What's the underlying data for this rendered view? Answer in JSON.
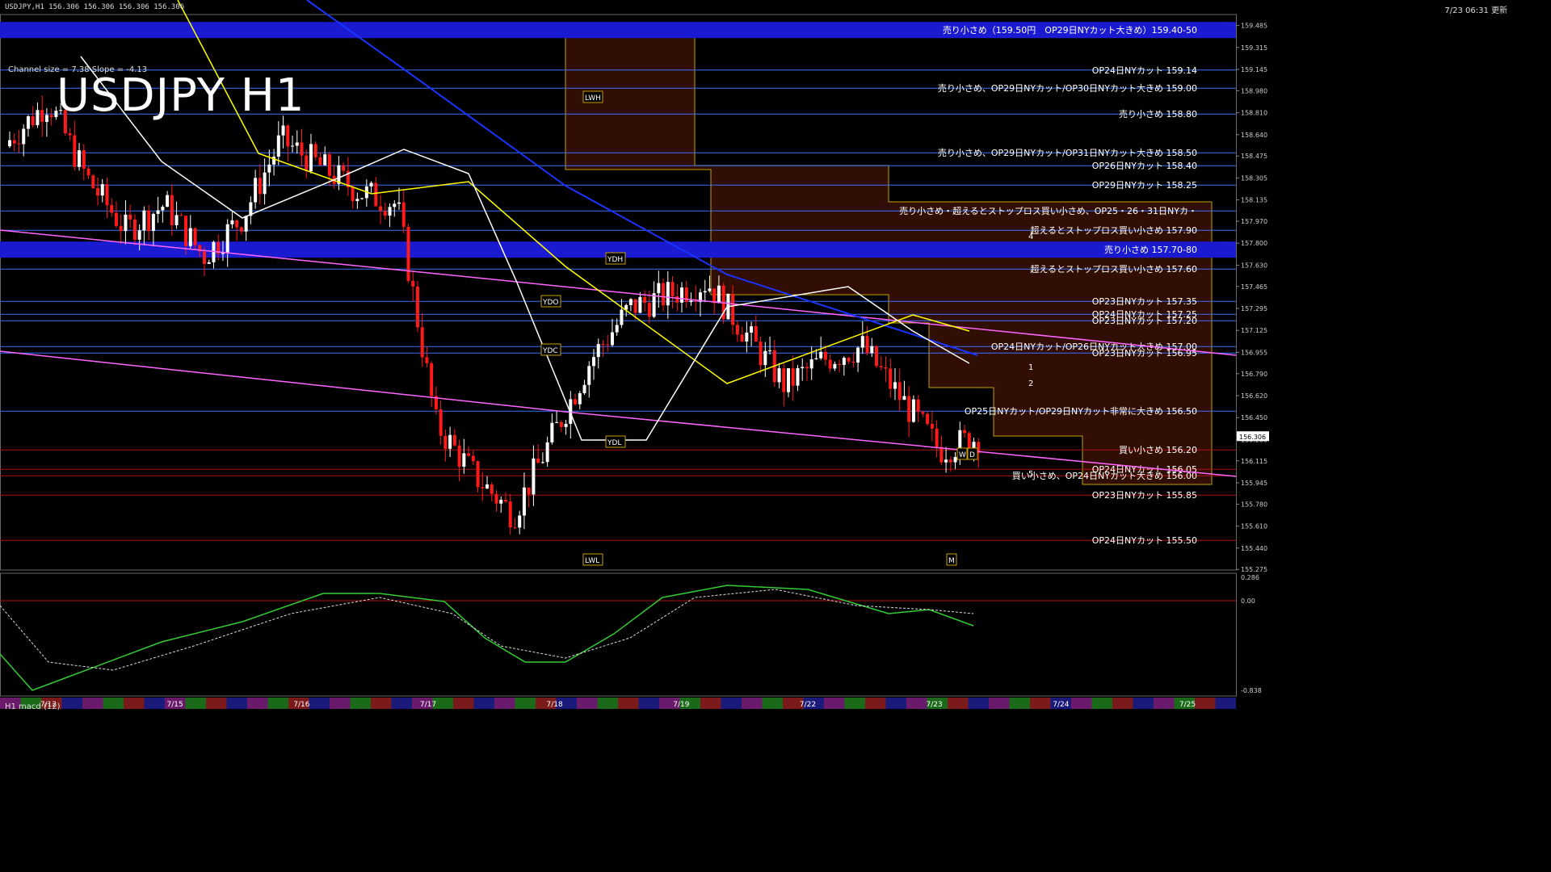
{
  "window": {
    "symbol_info": "USDJPY,H1  156.306 156.306 156.306 156.306",
    "updated_label": "7/23 06:31 更新",
    "channel_info": "Channel size = 7.38  Slope = -4.13",
    "title": "USDJPY H1",
    "macd_label": "H1 macd (12)"
  },
  "colors": {
    "background": "#000000",
    "resistance_band": "#1a1ad0",
    "level_line": "#3a6fff",
    "bear_candle": "#ff1a1a",
    "bull_candle": "#ffffff",
    "ichimoku_cloud": "#ff6633",
    "ma_white": "#ffffff",
    "ma_yellow": "#ffff00",
    "ma_blue": "#1a33ff",
    "trendline": "#ff66ff",
    "macd_main": "#33cc33",
    "macd_neg": "#ff6699"
  },
  "chart_data": {
    "type": "candlestick",
    "symbol": "USDJPY",
    "timeframe": "H1",
    "y_axis_ticks": [
      "159.485",
      "159.315",
      "159.145",
      "158.980",
      "158.810",
      "158.640",
      "158.475",
      "158.305",
      "158.135",
      "157.970",
      "157.800",
      "157.630",
      "157.465",
      "157.295",
      "157.125",
      "156.955",
      "156.790",
      "156.620",
      "156.450",
      "156.280",
      "156.115",
      "155.945",
      "155.780",
      "155.610",
      "155.440",
      "155.275"
    ],
    "ylim": [
      155.27,
      159.57
    ],
    "current_price_label": "156.306",
    "x_axis_dates": [
      "7/12",
      "7/15",
      "7/16",
      "7/17",
      "7/18",
      "7/19",
      "7/22",
      "7/23",
      "7/24",
      "7/25"
    ],
    "macd_axis": {
      "top": "0.286",
      "zero": "0.00",
      "bottom": "-0.838"
    },
    "option_levels": [
      {
        "label": "売り小さめ（159.50円　OP29日NYカット大きめ）159.40-50",
        "price": 159.45,
        "band": true
      },
      {
        "label": "OP24日NYカット 159.14",
        "price": 159.14
      },
      {
        "label": "売り小さめ、OP29日NYカット/OP30日NYカット大きめ 159.00",
        "price": 159.0
      },
      {
        "label": "売り小さめ 158.80",
        "price": 158.8
      },
      {
        "label": "売り小さめ、OP29日NYカット/OP31日NYカット大きめ 158.50",
        "price": 158.5
      },
      {
        "label": "OP26日NYカット 158.40",
        "price": 158.4
      },
      {
        "label": "OP29日NYカット 158.25",
        "price": 158.25
      },
      {
        "label": "売り小さめ・超えるとストップロス買い小さめ、OP25・26・31日NYカ・",
        "price": 158.05
      },
      {
        "label": "超えるとストップロス買い小さめ 157.90",
        "price": 157.9
      },
      {
        "label": "売り小さめ 157.70-80",
        "price": 157.75,
        "band": true
      },
      {
        "label": "超えるとストップロス買い小さめ 157.60",
        "price": 157.6
      },
      {
        "label": "OP23日NYカット 157.35",
        "price": 157.35
      },
      {
        "label": "OP24日NYカット 157.25",
        "price": 157.25
      },
      {
        "label": "OP23日NYカット 157.20",
        "price": 157.2
      },
      {
        "label": "OP24日NYカット/OP26日NYカット大きめ 157.00",
        "price": 157.0
      },
      {
        "label": "OP23日NYカット 156.95",
        "price": 156.95
      },
      {
        "label": "OP25日NYカット/OP29日NYカット非常に大きめ 156.50",
        "price": 156.5
      },
      {
        "label": "買い小さめ 156.20",
        "price": 156.2
      },
      {
        "label": "OP24日NYカット 156.05",
        "price": 156.05
      },
      {
        "label": "買い小さめ、OP24日NYカット大きめ 156.00",
        "price": 156.0
      },
      {
        "label": "OP23日NYカット 155.85",
        "price": 155.85
      },
      {
        "label": "OP24日NYカット 155.50",
        "price": 155.5
      }
    ],
    "markers": [
      {
        "label": "LWH"
      },
      {
        "label": "YDH"
      },
      {
        "label": "YDO"
      },
      {
        "label": "YDC"
      },
      {
        "label": "YDL"
      },
      {
        "label": "LWL"
      },
      {
        "label": "W"
      },
      {
        "label": "D"
      },
      {
        "label": "M"
      }
    ],
    "wave_labels": [
      "1",
      "2",
      "4",
      "5"
    ]
  }
}
